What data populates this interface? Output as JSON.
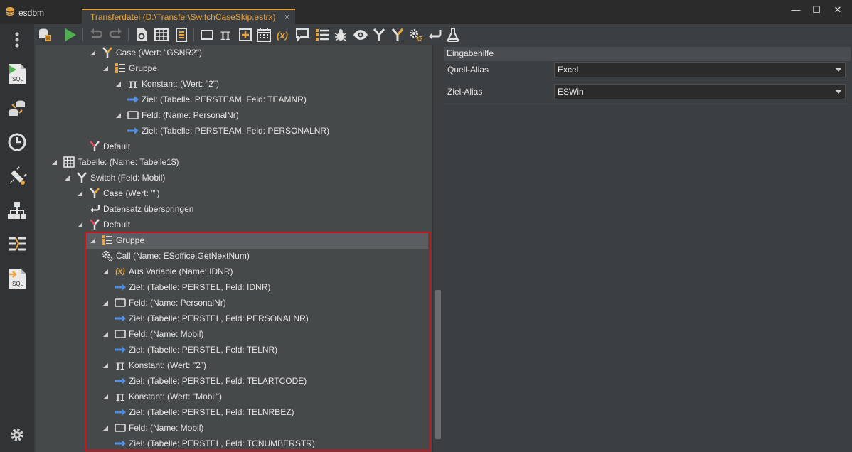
{
  "app": {
    "title": "esdbm"
  },
  "tab": {
    "label": "Transferdatei (D:\\Transfer\\SwitchCaseSkip.estrx)",
    "close": "×"
  },
  "window": {
    "minimize": "—",
    "maximize": "☐",
    "close": "✕"
  },
  "activity": [
    {
      "name": "more-menu-icon"
    },
    {
      "name": "sql-run-icon",
      "text": "SQL"
    },
    {
      "name": "database-transfer-icon"
    },
    {
      "name": "history-clock-icon"
    },
    {
      "name": "plugin-settings-icon"
    },
    {
      "name": "hierarchy-icon"
    },
    {
      "name": "data-mapping-icon"
    },
    {
      "name": "sql-export-icon",
      "text": "SQL"
    },
    {
      "name": "settings-gear-icon"
    }
  ],
  "toolbar": {
    "pi_glyph": "π",
    "variable_glyph": "(x)"
  },
  "tree": {
    "rows": [
      {
        "text": "Case (Wert: \"GSNR2\")",
        "icon": "case-icon"
      },
      {
        "text": "Gruppe",
        "icon": "group-icon"
      },
      {
        "text": "Konstant: (Wert: \"2\")",
        "icon": "constant-icon"
      },
      {
        "text": "Ziel: (Tabelle: PERSTEAM, Feld: TEAMNR)",
        "icon": "target-arrow-icon"
      },
      {
        "text": "Feld: (Name: PersonalNr)",
        "icon": "field-icon"
      },
      {
        "text": "Ziel: (Tabelle: PERSTEAM, Feld: PERSONALNR)",
        "icon": "target-arrow-icon"
      },
      {
        "text": "Default",
        "icon": "default-icon"
      },
      {
        "text": "Tabelle: (Name: Tabelle1$)",
        "icon": "table-icon"
      },
      {
        "text": "Switch (Feld: Mobil)",
        "icon": "switch-icon"
      },
      {
        "text": "Case (Wert: \"\")",
        "icon": "case-icon"
      },
      {
        "text": "Datensatz überspringen",
        "icon": "skip-record-icon"
      },
      {
        "text": "Default",
        "icon": "default-icon"
      },
      {
        "text": "Gruppe",
        "icon": "group-icon"
      },
      {
        "text": "Call (Name: ESoffice.GetNextNum)",
        "icon": "call-gear-icon"
      },
      {
        "text": "Aus Variable (Name: IDNR)",
        "icon": "variable-icon"
      },
      {
        "text": "Ziel: (Tabelle: PERSTEL, Feld: IDNR)",
        "icon": "target-arrow-icon"
      },
      {
        "text": "Feld: (Name: PersonalNr)",
        "icon": "field-icon"
      },
      {
        "text": "Ziel: (Tabelle: PERSTEL, Feld: PERSONALNR)",
        "icon": "target-arrow-icon"
      },
      {
        "text": "Feld: (Name: Mobil)",
        "icon": "field-icon"
      },
      {
        "text": "Ziel: (Tabelle: PERSTEL, Feld: TELNR)",
        "icon": "target-arrow-icon"
      },
      {
        "text": "Konstant: (Wert: \"2\")",
        "icon": "constant-icon"
      },
      {
        "text": "Ziel: (Tabelle: PERSTEL, Feld: TELARTCODE)",
        "icon": "target-arrow-icon"
      },
      {
        "text": "Konstant: (Wert: \"Mobil\")",
        "icon": "constant-icon"
      },
      {
        "text": "Ziel: (Tabelle: PERSTEL, Feld: TELNRBEZ)",
        "icon": "target-arrow-icon"
      },
      {
        "text": "Feld: (Name: Mobil)",
        "icon": "field-icon"
      },
      {
        "text": "Ziel: (Tabelle: PERSTEL, Feld: TCNUMBERSTR)",
        "icon": "target-arrow-icon"
      }
    ]
  },
  "properties": {
    "header": "Eingabehilfe",
    "source_alias": {
      "label": "Quell-Alias",
      "value": "Excel"
    },
    "target_alias": {
      "label": "Ziel-Alias",
      "value": "ESWin"
    }
  },
  "colors": {
    "accent": "#e8a33d",
    "highlight_border": "#d0131b",
    "arrow_blue": "#4f8fe6",
    "run_green": "#4fb04f"
  }
}
